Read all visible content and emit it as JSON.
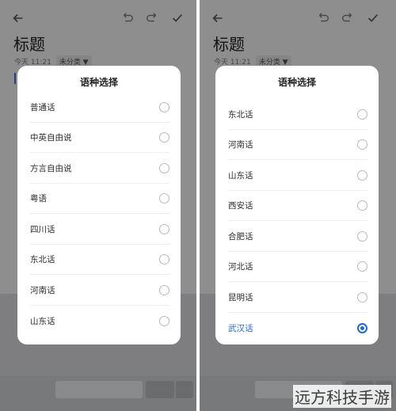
{
  "left": {
    "note": {
      "title": "标题",
      "time": "今天 11:21",
      "category": "未分类 ▼"
    },
    "dialog": {
      "title": "语种选择",
      "options": [
        {
          "label": "普通话",
          "selected": false
        },
        {
          "label": "中英自由说",
          "selected": false
        },
        {
          "label": "方言自由说",
          "selected": false
        },
        {
          "label": "粤语",
          "selected": false
        },
        {
          "label": "四川话",
          "selected": false
        },
        {
          "label": "东北话",
          "selected": false
        },
        {
          "label": "河南话",
          "selected": false
        },
        {
          "label": "山东话",
          "selected": false
        }
      ]
    }
  },
  "right": {
    "note": {
      "title": "标题",
      "time": "今天 11:21",
      "category": "未分类 ▼"
    },
    "dialog": {
      "title": "语种选择",
      "options": [
        {
          "label": "东北话",
          "selected": false
        },
        {
          "label": "河南话",
          "selected": false
        },
        {
          "label": "山东话",
          "selected": false
        },
        {
          "label": "西安话",
          "selected": false
        },
        {
          "label": "合肥话",
          "selected": false
        },
        {
          "label": "河北话",
          "selected": false
        },
        {
          "label": "昆明话",
          "selected": false
        },
        {
          "label": "武汉话",
          "selected": true
        }
      ]
    }
  },
  "colors": {
    "accent": "#1f66d9",
    "scrim": "rgba(0,0,0,0.42)"
  },
  "icons": [
    "back-arrow-icon",
    "undo-icon",
    "redo-icon",
    "check-icon",
    "radio-icon"
  ],
  "watermark": "远方科技手游"
}
